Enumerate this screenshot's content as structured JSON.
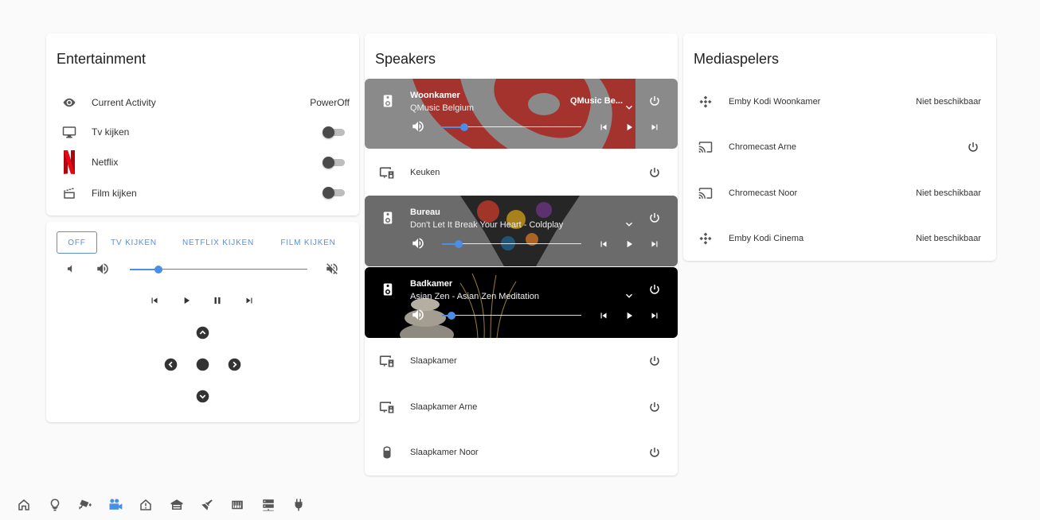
{
  "entertainment": {
    "title": "Entertainment",
    "rows": [
      {
        "icon": "eye-icon",
        "label": "Current Activity",
        "value": "PowerOff"
      },
      {
        "icon": "tv-icon",
        "label": "Tv kijken",
        "state": "off"
      },
      {
        "icon": "netflix-logo",
        "label": "Netflix",
        "state": "off"
      },
      {
        "icon": "clapperboard-icon",
        "label": "Film kijken",
        "state": "off"
      }
    ]
  },
  "remote": {
    "tabs": [
      "OFF",
      "TV KIJKEN",
      "NETFLIX KIJKEN",
      "FILM KIJKEN"
    ],
    "active_tab": "OFF",
    "volume_level": 0.16
  },
  "speakers": {
    "title": "Speakers",
    "players": [
      {
        "name": "Woonkamer",
        "subtitle": "QMusic Belgium",
        "source": "QMusic Be...",
        "volume": 0.16,
        "background": "#8c8c8c",
        "art_color": "#a8231c"
      },
      {
        "name": "Keuken"
      },
      {
        "name": "Bureau",
        "subtitle": "Don't Let It Break Your Heart - Coldplay",
        "volume": 0.12,
        "background": "#6d6d6d"
      },
      {
        "name": "Badkamer",
        "subtitle": "Asian Zen - Asian Zen Meditation",
        "volume": 0.07,
        "background": "#000000"
      },
      {
        "name": "Slaapkamer"
      },
      {
        "name": "Slaapkamer Arne"
      },
      {
        "name": "Slaapkamer Noor"
      }
    ]
  },
  "mediaspelers": {
    "title": "Mediaspelers",
    "items": [
      {
        "icon": "kodi-icon",
        "label": "Emby Kodi Woonkamer",
        "status": "Niet beschikbaar"
      },
      {
        "icon": "cast-icon",
        "label": "Chromecast Arne",
        "status": ""
      },
      {
        "icon": "cast-icon",
        "label": "Chromecast Noor",
        "status": "Niet beschikbaar"
      },
      {
        "icon": "kodi-icon",
        "label": "Emby Kodi Cinema",
        "status": "Niet beschikbaar"
      }
    ]
  },
  "bottom_nav": {
    "icons": [
      "home-icon",
      "lightbulb-icon",
      "cctv-icon",
      "video-camera-icon",
      "home-alert-icon",
      "garage-icon",
      "broom-icon",
      "piano-icon",
      "server-icon",
      "power-plug-icon"
    ],
    "active_index": 3,
    "accent": "#4a8ee6"
  }
}
